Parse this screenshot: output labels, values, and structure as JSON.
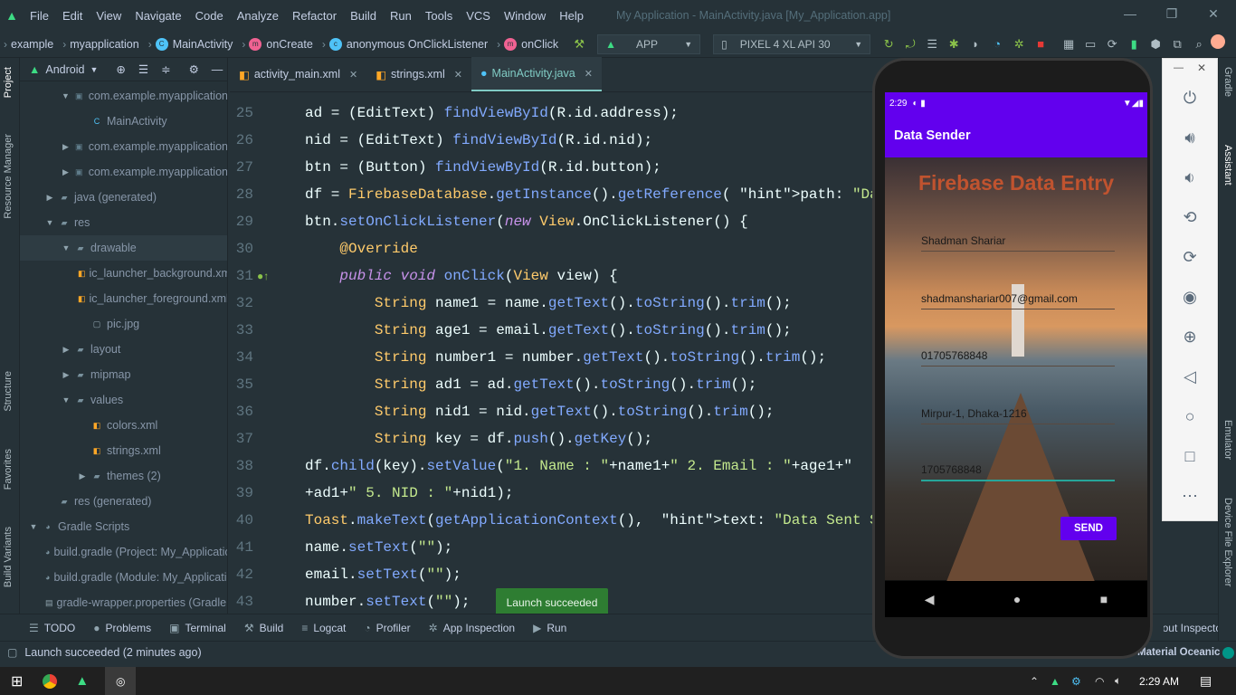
{
  "window": {
    "title": "My Application - MainActivity.java [My_Application.app]"
  },
  "menu": [
    "File",
    "Edit",
    "View",
    "Navigate",
    "Code",
    "Analyze",
    "Refactor",
    "Build",
    "Run",
    "Tools",
    "VCS",
    "Window",
    "Help"
  ],
  "breadcrumbs": [
    "example",
    "myapplication",
    "MainActivity",
    "onCreate",
    "anonymous OnClickListener",
    "onClick"
  ],
  "run_config": {
    "app": "APP",
    "device": "PIXEL 4 XL API 30"
  },
  "left_strip": {
    "project": "Project",
    "resource_manager": "Resource Manager",
    "structure": "Structure",
    "favorites": "Favorites",
    "build_variants": "Build Variants"
  },
  "project_panel": {
    "view": "Android"
  },
  "tree": [
    {
      "label": "com.example.myapplication",
      "depth": 2,
      "type": "package",
      "expanded": true
    },
    {
      "label": "MainActivity",
      "depth": 3,
      "type": "class"
    },
    {
      "label": "com.example.myapplication",
      "depth": 2,
      "type": "package",
      "expanded": false
    },
    {
      "label": "com.example.myapplication",
      "depth": 2,
      "type": "package",
      "expanded": false
    },
    {
      "label": "java (generated)",
      "depth": 1,
      "type": "folder",
      "expanded": false
    },
    {
      "label": "res",
      "depth": 1,
      "type": "folder",
      "expanded": true
    },
    {
      "label": "drawable",
      "depth": 2,
      "type": "folder",
      "expanded": true,
      "selected": true
    },
    {
      "label": "ic_launcher_background.xml",
      "depth": 3,
      "type": "xml"
    },
    {
      "label": "ic_launcher_foreground.xml",
      "depth": 3,
      "type": "xml"
    },
    {
      "label": "pic.jpg",
      "depth": 3,
      "type": "image"
    },
    {
      "label": "layout",
      "depth": 2,
      "type": "folder",
      "expanded": false
    },
    {
      "label": "mipmap",
      "depth": 2,
      "type": "folder",
      "expanded": false
    },
    {
      "label": "values",
      "depth": 2,
      "type": "folder",
      "expanded": true
    },
    {
      "label": "colors.xml",
      "depth": 3,
      "type": "xml"
    },
    {
      "label": "strings.xml",
      "depth": 3,
      "type": "xml"
    },
    {
      "label": "themes (2)",
      "depth": 3,
      "type": "folder",
      "expanded": false
    },
    {
      "label": "res (generated)",
      "depth": 1,
      "type": "folder"
    },
    {
      "label": "Gradle Scripts",
      "depth": 0,
      "type": "gradle",
      "expanded": true
    },
    {
      "label": "build.gradle (Project: My_Application)",
      "depth": 1,
      "type": "gradle"
    },
    {
      "label": "build.gradle (Module: My_Application.app)",
      "depth": 1,
      "type": "gradle"
    },
    {
      "label": "gradle-wrapper.properties (Gradle Version)",
      "depth": 1,
      "type": "props"
    }
  ],
  "tabs": [
    {
      "label": "activity_main.xml"
    },
    {
      "label": "strings.xml"
    },
    {
      "label": "MainActivity.java",
      "active": true
    }
  ],
  "editor": {
    "line_numbers": [
      "25",
      "26",
      "27",
      "28",
      "29",
      "30",
      "31",
      "32",
      "33",
      "34",
      "35",
      "36",
      "37",
      "38",
      "39",
      "40",
      "41",
      "42",
      "43"
    ],
    "lines": [
      "ad = (EditText) findViewById(R.id.address);",
      "nid = (EditText) findViewById(R.id.nid);",
      "btn = (Button) findViewById(R.id.button);",
      "df = FirebaseDatabase.getInstance().getReference( path: \"Data\");",
      "btn.setOnClickListener(new View.OnClickListener() {",
      "    @Override",
      "    public void onClick(View view) {",
      "        String name1 = name.getText().toString().trim();",
      "        String age1 = email.getText().toString().trim();",
      "        String number1 = number.getText().toString().trim();",
      "        String ad1 = ad.getText().toString().trim();",
      "        String nid1 = nid.getText().toString().trim();",
      "        String key = df.push().getKey();",
      "df.child(key).setValue(\"1. Name : \"+name1+\" 2. Email : \"+age1+\"",
      "+ad1+\" 5. NID : \"+nid1);",
      "Toast.makeText(getApplicationContext(),  text: \"Data Sent Successfully\"",
      "name.setText(\"\");",
      "email.setText(\"\");",
      "number.setText(\"\");"
    ]
  },
  "toast": "Launch succeeded",
  "bottom_tools": [
    "TODO",
    "Problems",
    "Terminal",
    "Build",
    "Logcat",
    "Profiler",
    "App Inspection",
    "Run"
  ],
  "status": {
    "message": "Launch succeeded (2 minutes ago)",
    "theme": "Material Oceanic",
    "layout_inspector": "Layout Inspector"
  },
  "right_strip": {
    "gradle": "Gradle",
    "assistant": "Assistant",
    "emulator": "Emulator",
    "device_file_explorer": "Device File Explorer"
  },
  "phone": {
    "time": "2:29",
    "app_title": "Data Sender",
    "heading": "Firebase Data Entry",
    "fields": [
      "Shadman Shariar",
      "shadmanshariar007@gmail.com",
      "01705768848",
      "Mirpur-1, Dhaka-1216",
      "1705768848"
    ],
    "send": "SEND"
  },
  "taskbar": {
    "time": "2:29 AM"
  }
}
